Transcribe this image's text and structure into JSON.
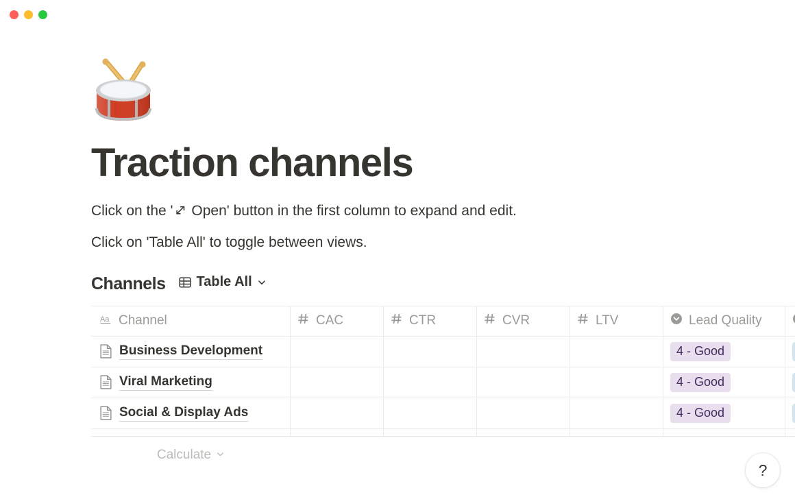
{
  "window": {
    "traffic_lights": [
      {
        "name": "close",
        "color": "#ff5f57"
      },
      {
        "name": "minimize",
        "color": "#febc2e"
      },
      {
        "name": "zoom",
        "color": "#28c840"
      }
    ]
  },
  "page": {
    "emoji": "🥁",
    "emoji_name": "drum-emoji",
    "title": "Traction channels",
    "paragraphs": [
      {
        "before": "Click on the '",
        "icon": "expand-arrow-icon",
        "after": " Open' button in the first column to expand and edit."
      },
      {
        "before": "Click on 'Table All' to toggle between views.",
        "icon": null,
        "after": ""
      }
    ]
  },
  "database": {
    "title": "Channels",
    "view_label": "Table All",
    "view_icon": "table-icon",
    "chevron_icon": "chevron-down-icon",
    "columns": [
      {
        "label": "Channel",
        "type_icon": "text-property-icon",
        "kind": "title"
      },
      {
        "label": "CAC",
        "type_icon": "number-property-icon",
        "kind": "number"
      },
      {
        "label": "CTR",
        "type_icon": "number-property-icon",
        "kind": "number"
      },
      {
        "label": "CVR",
        "type_icon": "number-property-icon",
        "kind": "number"
      },
      {
        "label": "LTV",
        "type_icon": "number-property-icon",
        "kind": "number"
      },
      {
        "label": "Lead Quality",
        "type_icon": "select-property-icon",
        "kind": "select"
      },
      {
        "label": "",
        "type_icon": "select-property-icon",
        "kind": "select"
      }
    ],
    "rows": [
      {
        "icon": "page-icon",
        "channel": "Business Development",
        "cac": "",
        "ctr": "",
        "cvr": "",
        "ltv": "",
        "lead_quality": "4 - Good",
        "extra_tag": ""
      },
      {
        "icon": "page-icon",
        "channel": "Viral Marketing",
        "cac": "",
        "ctr": "",
        "cvr": "",
        "ltv": "",
        "lead_quality": "4 - Good",
        "extra_tag": ""
      },
      {
        "icon": "page-icon",
        "channel": "Social & Display Ads",
        "cac": "",
        "ctr": "",
        "cvr": "",
        "ltv": "",
        "lead_quality": "4 - Good",
        "extra_tag": ""
      }
    ],
    "footer": {
      "calculate_label": "Calculate",
      "chevron_icon": "chevron-down-icon"
    },
    "colors": {
      "tag_purple_bg": "#e8deee",
      "tag_purple_fg": "#412d5c",
      "tag_blue_bg": "#d3e5ef",
      "border": "#eceae6",
      "text": "#37352f",
      "muted": "#9b9a97"
    }
  },
  "help": {
    "label": "?"
  }
}
